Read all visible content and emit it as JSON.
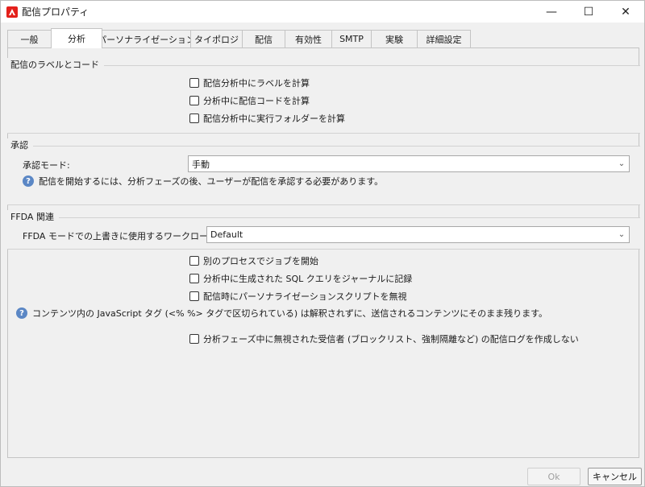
{
  "window": {
    "title": "配信プロパティ",
    "minimize": "—",
    "maximize": "☐",
    "close": "✕"
  },
  "tabs": [
    {
      "label": "一般"
    },
    {
      "label": "分析"
    },
    {
      "label": "パーソナライゼーション"
    },
    {
      "label": "タイポロジ"
    },
    {
      "label": "配信"
    },
    {
      "label": "有効性"
    },
    {
      "label": "SMTP"
    },
    {
      "label": "実験"
    },
    {
      "label": "詳細設定"
    }
  ],
  "active_tab": "分析",
  "labels_group": {
    "title": "配信のラベルとコード",
    "checkboxes": [
      {
        "label": "配信分析中にラベルを計算",
        "checked": false
      },
      {
        "label": "分析中に配信コードを計算",
        "checked": false
      },
      {
        "label": "配信分析中に実行フォルダーを計算",
        "checked": false
      }
    ]
  },
  "approval_group": {
    "title": "承認",
    "mode_label": "承認モード:",
    "mode_value": "手動",
    "info": "配信を開始するには、分析フェーズの後、ユーザーが配信を承認する必要があります。"
  },
  "ffda_group": {
    "title": "FFDA 関連",
    "workload_label": "FFDA モードでの上書きに使用するワークロードタイプ:",
    "workload_value": "Default"
  },
  "options": [
    {
      "label": "別のプロセスでジョブを開始",
      "checked": false
    },
    {
      "label": "分析中に生成された SQL クエリをジャーナルに記録",
      "checked": false
    },
    {
      "label": "配信時にパーソナライゼーションスクリプトを無視",
      "checked": false
    }
  ],
  "js_info": "コンテンツ内の JavaScript タグ (<% %> タグで区切られている) は解釈されずに、送信されるコンテンツにそのまま残ります。",
  "no_log_option": {
    "label": "分析フェーズ中に無視された受信者 (ブロックリスト、強制隔離など) の配信ログを作成しない",
    "checked": false
  },
  "footer": {
    "ok": "Ok",
    "cancel": "キャンセル"
  },
  "colors": {
    "brand": "#e4201b",
    "info": "#5b87c5"
  },
  "icons": {
    "app": "adobe-logo-icon",
    "info": "question-circle-icon",
    "dropdown": "chevron-down-icon"
  }
}
